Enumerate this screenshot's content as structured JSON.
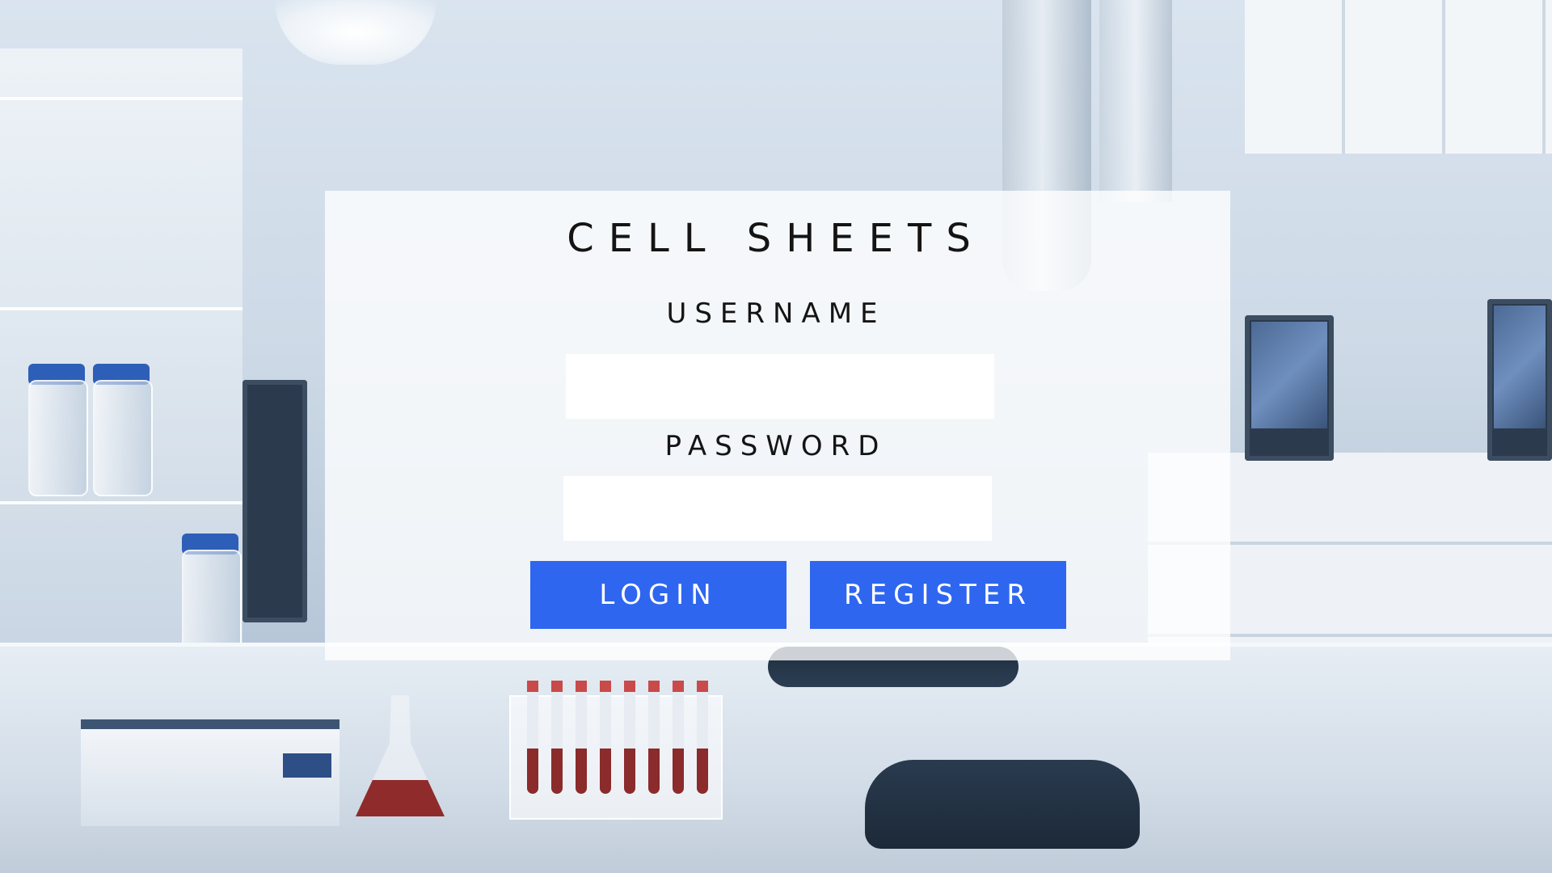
{
  "app": {
    "title": "CELL SHEETS"
  },
  "form": {
    "username_label": "USERNAME",
    "username_value": "",
    "password_label": "PASSWORD",
    "password_value": ""
  },
  "actions": {
    "login_label": "LOGIN",
    "register_label": "REGISTER"
  },
  "colors": {
    "button": "#2f66f0",
    "panel": "rgba(255,255,255,0.78)",
    "text": "#141414"
  }
}
